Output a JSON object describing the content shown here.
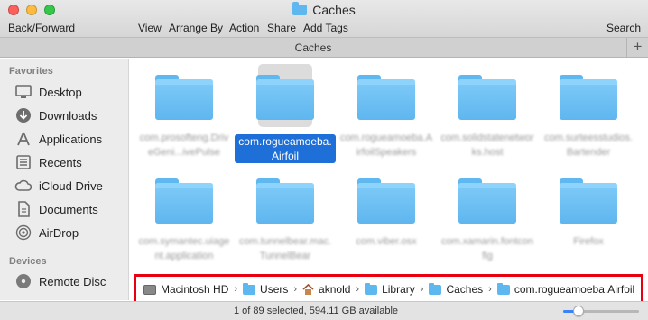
{
  "window": {
    "title": "Caches",
    "tab_title": "Caches",
    "tab_add": "+"
  },
  "toolbar": {
    "back_forward": "Back/Forward",
    "view": "View",
    "arrange_by": "Arrange By",
    "action": "Action",
    "share": "Share",
    "add_tags": "Add Tags",
    "search": "Search"
  },
  "sidebar": {
    "favorites_heading": "Favorites",
    "devices_heading": "Devices",
    "favorites": [
      {
        "label": "Desktop",
        "icon": "desktop-icon"
      },
      {
        "label": "Downloads",
        "icon": "downloads-icon"
      },
      {
        "label": "Applications",
        "icon": "applications-icon"
      },
      {
        "label": "Recents",
        "icon": "recents-icon"
      },
      {
        "label": "iCloud Drive",
        "icon": "icloud-icon"
      },
      {
        "label": "Documents",
        "icon": "documents-icon"
      },
      {
        "label": "AirDrop",
        "icon": "airdrop-icon"
      }
    ],
    "devices": [
      {
        "label": "Remote Disc",
        "icon": "disc-icon"
      }
    ]
  },
  "files": [
    {
      "name": "com.prosofteng.DriveGeni...ivePulse",
      "selected": false
    },
    {
      "name": "com.rogueamoeba.Airfoil",
      "selected": true
    },
    {
      "name": "com.rogueamoeba.AirfoilSpeakers",
      "selected": false
    },
    {
      "name": "com.solidstatenetworks.host",
      "selected": false
    },
    {
      "name": "com.surteesstudios.Bartender",
      "selected": false
    },
    {
      "name": "com.symantec.uiagent.application",
      "selected": false
    },
    {
      "name": "com.tunnelbear.mac.TunnelBear",
      "selected": false
    },
    {
      "name": "com.viber.osx",
      "selected": false
    },
    {
      "name": "com.xamarin.fontconfig",
      "selected": false
    },
    {
      "name": "Firefox",
      "selected": false
    }
  ],
  "path": [
    {
      "label": "Macintosh HD",
      "icon": "hard-drive-icon"
    },
    {
      "label": "Users",
      "icon": "folder-icon"
    },
    {
      "label": "aknold",
      "icon": "home-icon"
    },
    {
      "label": "Library",
      "icon": "folder-icon"
    },
    {
      "label": "Caches",
      "icon": "folder-icon"
    },
    {
      "label": "com.rogueamoeba.Airfoil",
      "icon": "folder-icon"
    }
  ],
  "path_separator": "›",
  "status": {
    "text": "1 of 89 selected, 594.11 GB available",
    "icon_size_level": 0.2
  },
  "colors": {
    "accent": "#1f6fd8",
    "highlight_box": "#e8000e",
    "folder": "#5fb7f0"
  }
}
